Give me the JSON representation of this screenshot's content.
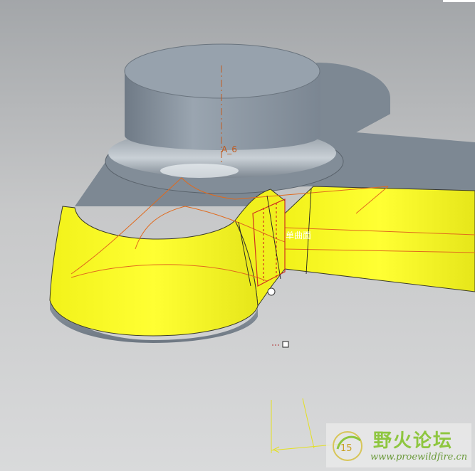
{
  "viewport": {
    "axis_label": "A_6",
    "surface_label": "单曲面"
  },
  "watermark": {
    "title": "野火论坛",
    "url": "www.proewildfire.cn",
    "badge": "15"
  },
  "colors": {
    "model_gray": "#8a949f",
    "highlight_yellow": "#ffff2a",
    "curve_orange": "#e06a1e",
    "edge_red": "#d03020"
  }
}
